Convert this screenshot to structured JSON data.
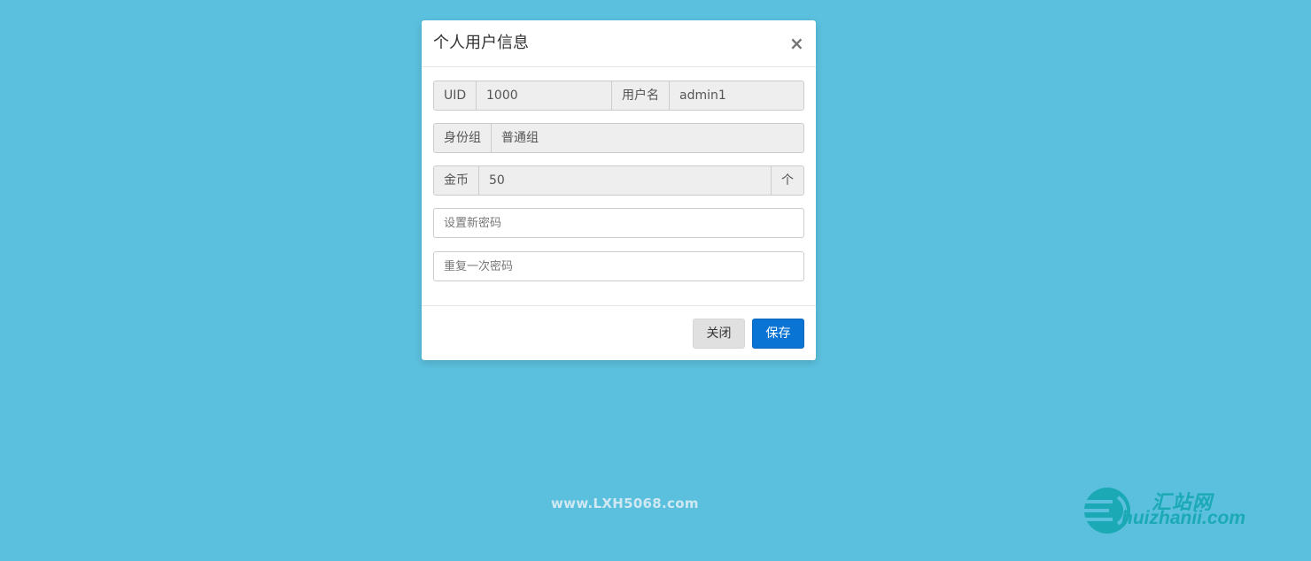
{
  "modal": {
    "title": "个人用户信息",
    "close_icon": "close-icon",
    "fields": {
      "uid_label": "UID",
      "uid_value": "1000",
      "username_label": "用户名",
      "username_value": "admin1",
      "group_label": "身份组",
      "group_value": "普通组",
      "coins_label": "金币",
      "coins_value": "50",
      "coins_unit": "个"
    },
    "new_password_placeholder": "设置新密码",
    "repeat_password_placeholder": "重复一次密码",
    "buttons": {
      "close_label": "关闭",
      "save_label": "保存"
    }
  },
  "footer": {
    "site": "www.LXH5068.com"
  },
  "watermark": {
    "cn": "汇站网",
    "en": "huizhanii.com"
  },
  "colors": {
    "background": "#5bc0de",
    "primary": "#0a74d4",
    "watermark": "#1aa9b5"
  }
}
